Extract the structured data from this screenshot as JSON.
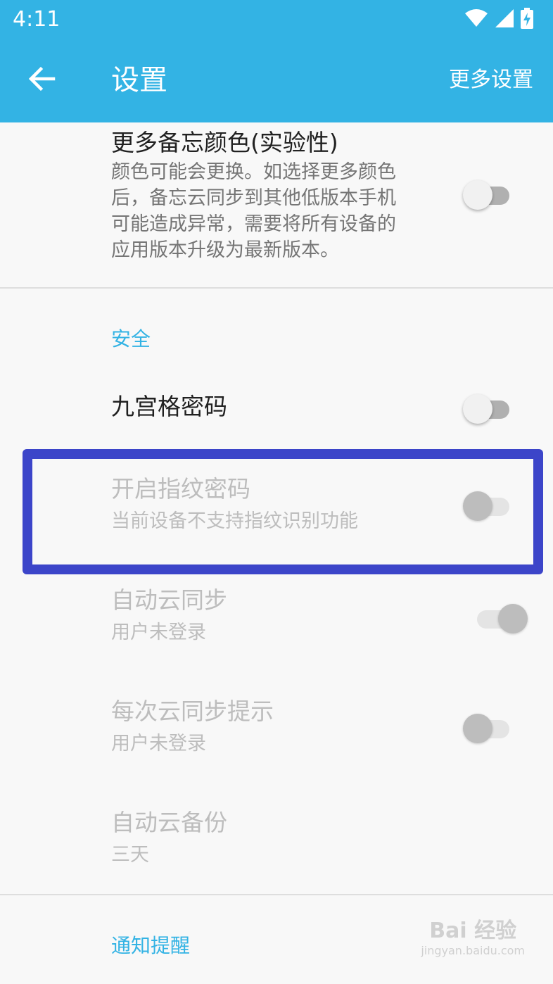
{
  "status_bar": {
    "time": "4:11",
    "icons": [
      "wifi-icon",
      "signal-icon",
      "battery-charging-icon"
    ]
  },
  "app_bar": {
    "title": "设置",
    "more_label": "更多设置",
    "back_icon": "arrow-left-icon",
    "color": "#33b3e4"
  },
  "prefs": {
    "more_colors": {
      "title": "更多备忘颜色(实验性)",
      "summary_lines": [
        "颜色可能会更换。如选择更多颜色",
        "后，备忘云同步到其他低版本手机",
        "可能造成异常，需要将所有设备的",
        "应用版本升级为最新版本。"
      ],
      "enabled": true,
      "checked": false
    },
    "security_header": "安全",
    "pattern_lock": {
      "title": "九宫格密码",
      "enabled": true,
      "checked": false
    },
    "fingerprint": {
      "title": "开启指纹密码",
      "summary": "当前设备不支持指纹识别功能",
      "enabled": false,
      "checked": false
    },
    "auto_sync": {
      "title": "自动云同步",
      "summary": "用户未登录",
      "enabled": false,
      "checked": true
    },
    "sync_prompt": {
      "title": "每次云同步提示",
      "summary": "用户未登录",
      "enabled": false,
      "checked": false
    },
    "auto_backup": {
      "title": "自动云备份",
      "summary": "三天",
      "enabled": false
    },
    "notify_header": "通知提醒"
  },
  "highlight_color": "#3c45c9",
  "watermark": {
    "main": "Bai 经验",
    "sub": "jingyan.baidu.com"
  }
}
